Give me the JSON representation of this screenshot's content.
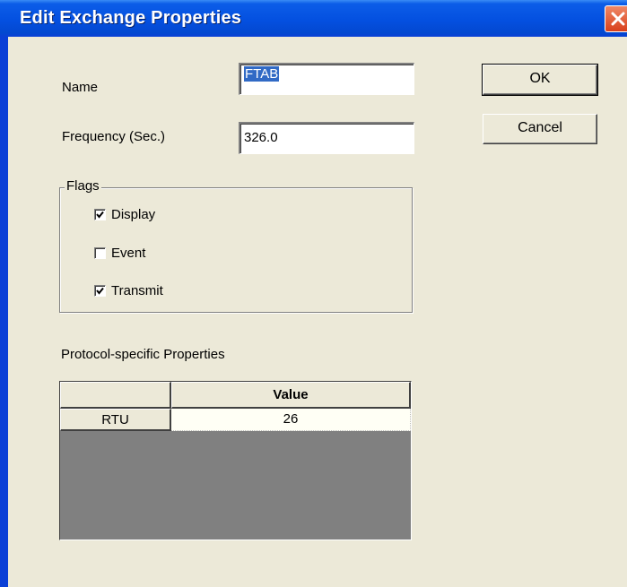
{
  "window": {
    "title": "Edit Exchange Properties"
  },
  "fields": {
    "name_label": "Name",
    "name_value": "FTAB",
    "frequency_label": "Frequency (Sec.)",
    "frequency_value": "326.0"
  },
  "buttons": {
    "ok": "OK",
    "cancel": "Cancel"
  },
  "flags": {
    "legend": "Flags",
    "items": [
      {
        "label": "Display",
        "checked": true
      },
      {
        "label": "Event",
        "checked": false
      },
      {
        "label": "Transmit",
        "checked": true
      }
    ]
  },
  "protocol": {
    "title": "Protocol-specific Properties",
    "columns": [
      "",
      "Value"
    ],
    "rows": [
      {
        "header": "RTU",
        "value": "26"
      }
    ]
  },
  "colors": {
    "titlebar": "#0450e0",
    "selection": "#316ac5",
    "dialog_bg": "#ece9d8"
  },
  "icons": {
    "close": "close-icon",
    "check": "checkmark-icon"
  }
}
